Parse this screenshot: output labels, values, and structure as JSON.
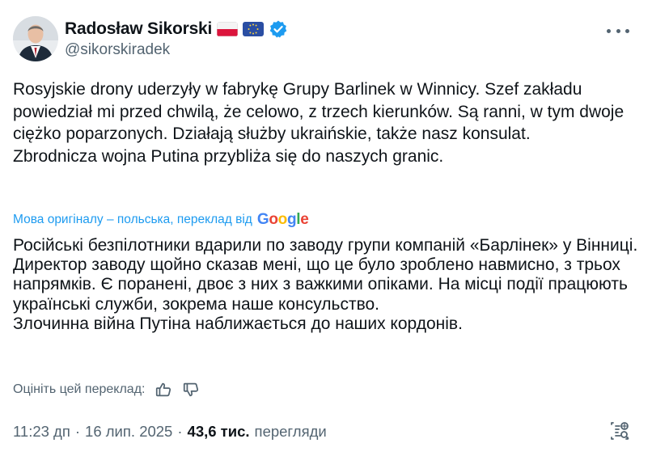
{
  "author": {
    "name": "Radosław Sikorski",
    "handle": "@sikorskiradek",
    "flags": [
      "poland-flag",
      "eu-flag"
    ],
    "verified": true
  },
  "colors": {
    "accent": "#1d9bf0",
    "text": "#0f1419",
    "secondary": "#536471"
  },
  "tweet": {
    "original_paragraphs": [
      "Rosyjskie drony uderzyły w fabrykę Grupy Barlinek w Winnicy. Szef zakładu powiedział mi przed chwilą, że celowo, z trzech kierunków. Są ranni, w tym dwoje ciężko poparzonych. Działają służby ukraińskie, także nasz konsulat.",
      "Zbrodnicza wojna Putina przybliża się do naszych granic."
    ],
    "translation_label": "Мова оригіналу – польська, переклад від",
    "translation_provider": "Google",
    "translated_paragraphs": [
      "Російські безпілотники вдарили по заводу групи компаній «Барлінек» у Вінниці. Директор заводу щойно сказав мені, що це було зроблено навмисно, з трьох напрямків. Є поранені, двоє з них з важкими опіками. На місці події працюють українські служби, зокрема наше консульство.",
      "Злочинна війна Путіна наближається до наших кордонів."
    ],
    "rate_label": "Оцініть цей переклад:",
    "time": "11:23 дп",
    "separator": "·",
    "date": "16 лип. 2025",
    "views_count": "43,6 тис.",
    "views_label": "перегляди"
  },
  "icons": {
    "more": "more-icon",
    "verified": "verified-badge-icon",
    "thumbs_up": "thumbs-up-icon",
    "thumbs_down": "thumbs-down-icon",
    "grok": "grok-analytics-icon"
  }
}
